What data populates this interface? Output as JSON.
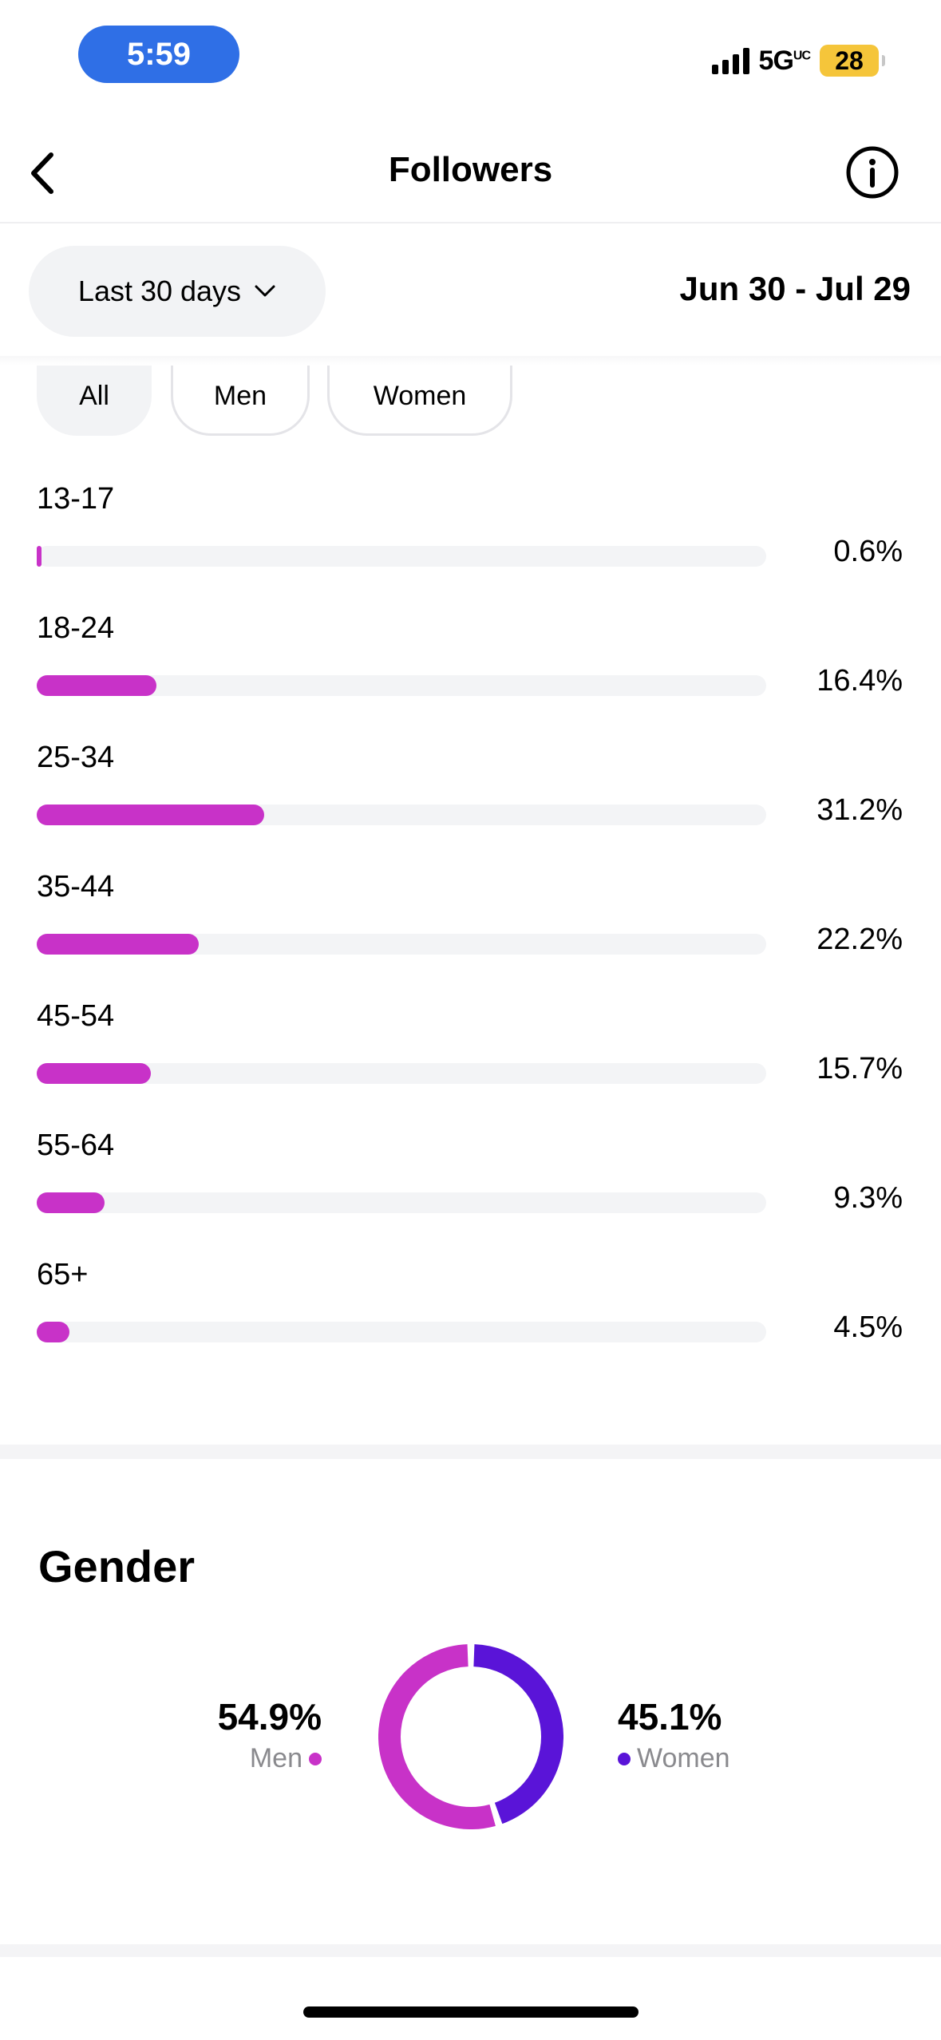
{
  "status_bar": {
    "time": "5:59",
    "network": "5G",
    "network_super": "UC",
    "battery": "28"
  },
  "nav": {
    "title": "Followers",
    "back_icon": "chevron-left-icon",
    "info_icon": "info-circle-icon"
  },
  "range": {
    "label": "Last 30 days",
    "dates": "Jun 30 - Jul 29"
  },
  "filters": [
    {
      "label": "All",
      "selected": true
    },
    {
      "label": "Men",
      "selected": false
    },
    {
      "label": "Women",
      "selected": false
    }
  ],
  "colors": {
    "accent_magenta": "#c832c8",
    "accent_purple": "#5a14d8",
    "track": "#f3f4f6"
  },
  "age_groups": [
    {
      "label": "13-17",
      "value": "0.6%",
      "pct": 0.6
    },
    {
      "label": "18-24",
      "value": "16.4%",
      "pct": 16.4
    },
    {
      "label": "25-34",
      "value": "31.2%",
      "pct": 31.2
    },
    {
      "label": "35-44",
      "value": "22.2%",
      "pct": 22.2
    },
    {
      "label": "45-54",
      "value": "15.7%",
      "pct": 15.7
    },
    {
      "label": "55-64",
      "value": "9.3%",
      "pct": 9.3
    },
    {
      "label": "65+",
      "value": "4.5%",
      "pct": 4.5
    }
  ],
  "gender": {
    "title": "Gender",
    "men": {
      "label": "Men",
      "value": "54.9%",
      "pct": 54.9
    },
    "women": {
      "label": "Women",
      "value": "45.1%",
      "pct": 45.1
    }
  }
}
